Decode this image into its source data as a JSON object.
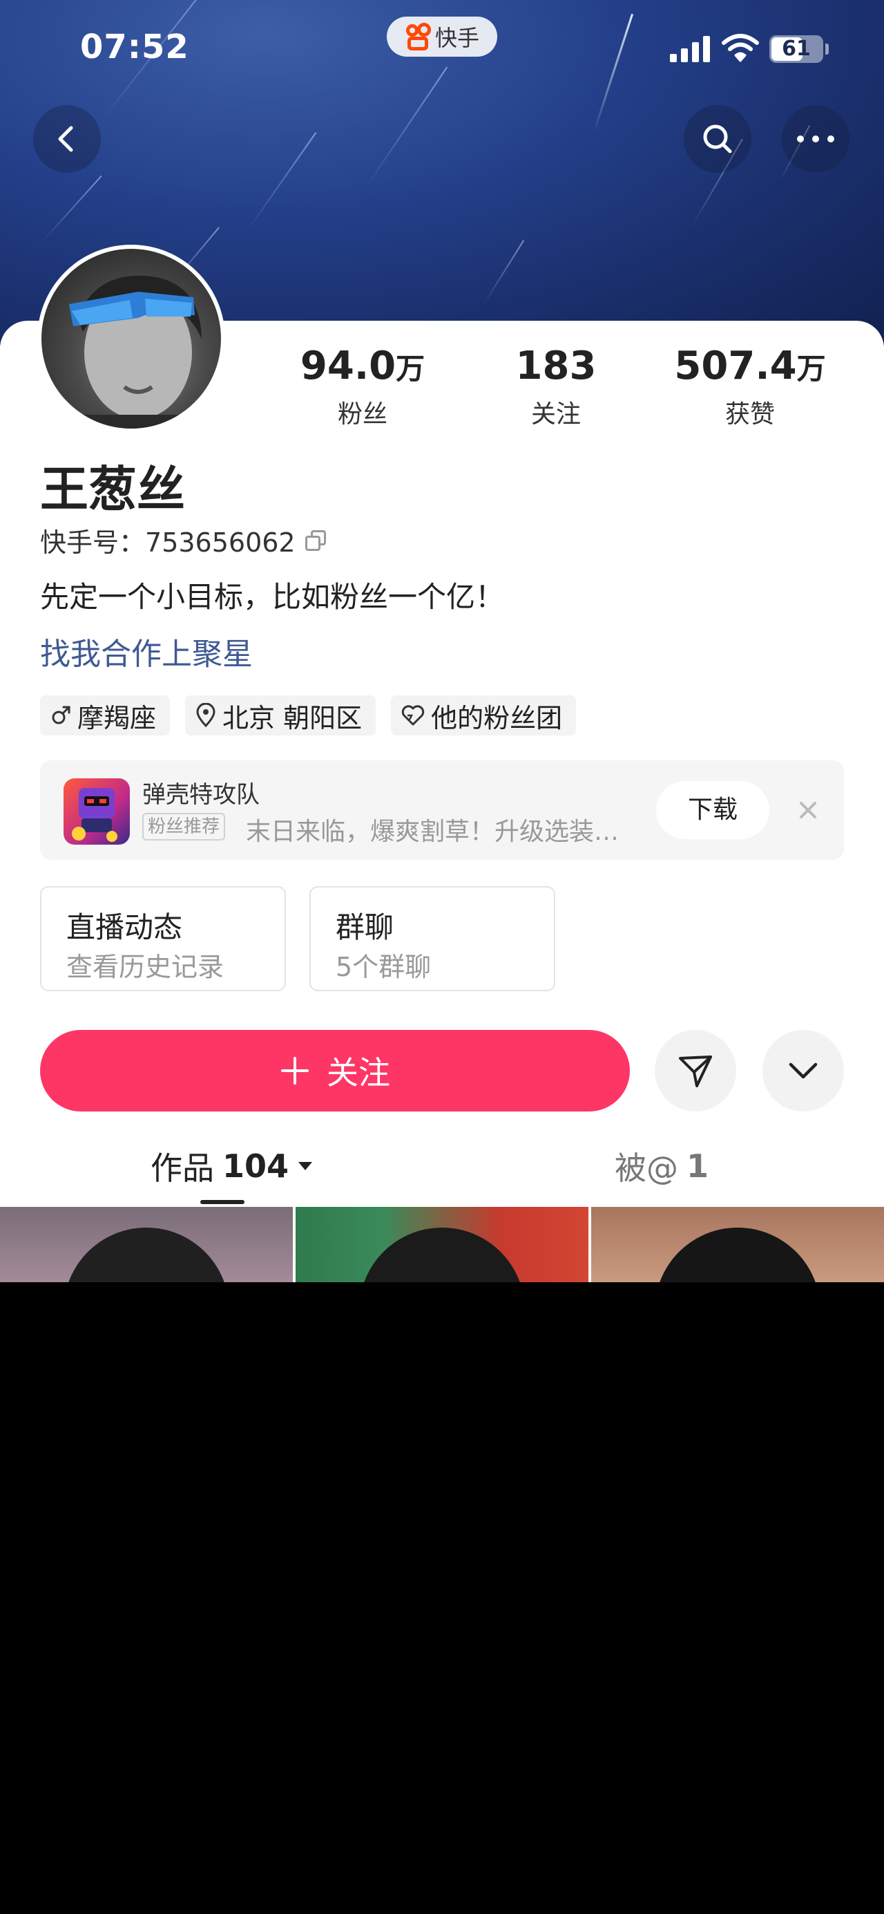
{
  "status_bar": {
    "time": "07:52",
    "battery": "61"
  },
  "app_pill": {
    "name": "快手"
  },
  "profile": {
    "stats": [
      {
        "value": "94.0",
        "unit": "万",
        "label": "粉丝"
      },
      {
        "value": "183",
        "unit": "",
        "label": "关注"
      },
      {
        "value": "507.4",
        "unit": "万",
        "label": "获赞"
      }
    ],
    "name": "王葱丝",
    "kuaishou_id_label": "快手号：",
    "kuaishou_id": "753656062",
    "bio": "先定一个小目标，比如粉丝一个亿！",
    "cooperation_link": "找我合作上聚星",
    "tags": [
      {
        "icon": "male-icon",
        "label": "摩羯座"
      },
      {
        "icon": "location-pin-icon",
        "label": "北京 朝阳区"
      },
      {
        "icon": "heart-icon",
        "label": "他的粉丝团"
      }
    ]
  },
  "ad": {
    "title": "弹壳特攻队",
    "badge": "粉丝推荐",
    "description": "末日来临，爆爽割草！升级选装…",
    "download_label": "下载"
  },
  "entries": [
    {
      "title": "直播动态",
      "subtitle": "查看历史记录"
    },
    {
      "title": "群聊",
      "subtitle": "5个群聊"
    }
  ],
  "actions": {
    "follow_label": "关注"
  },
  "content_tabs": [
    {
      "label": "作品",
      "count": "104"
    },
    {
      "label": "被@",
      "count": "1"
    }
  ],
  "colors": {
    "accent": "#fe3666",
    "link": "#3f5a93",
    "banner": "#24408a",
    "brand_orange": "#ff4906"
  }
}
